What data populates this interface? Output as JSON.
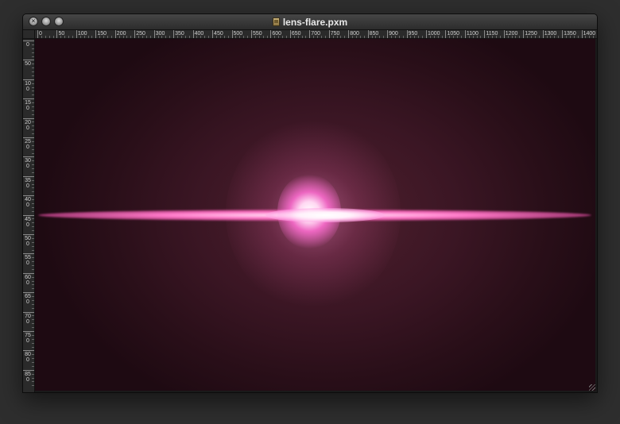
{
  "window": {
    "title": "lens-flare.pxm",
    "controls": [
      "close-button",
      "minimize-button",
      "zoom-button"
    ]
  },
  "rulers": {
    "horizontal": [
      "0",
      "50",
      "100",
      "150",
      "200",
      "250",
      "300",
      "350",
      "400",
      "450",
      "500",
      "550",
      "600",
      "650",
      "700",
      "750",
      "800",
      "850",
      "900",
      "950",
      "1000",
      "1050",
      "1100",
      "1150",
      "1200",
      "1250",
      "1300",
      "1350",
      "1400"
    ],
    "vertical": [
      "0",
      "50",
      "100",
      "150",
      "200",
      "250",
      "300",
      "350",
      "400",
      "450",
      "500",
      "550",
      "600",
      "650",
      "700",
      "750",
      "800",
      "850"
    ]
  },
  "canvas": {
    "colors": {
      "background": "#2a0f19",
      "glow": "#ff78c8",
      "core": "#ffffff"
    }
  }
}
